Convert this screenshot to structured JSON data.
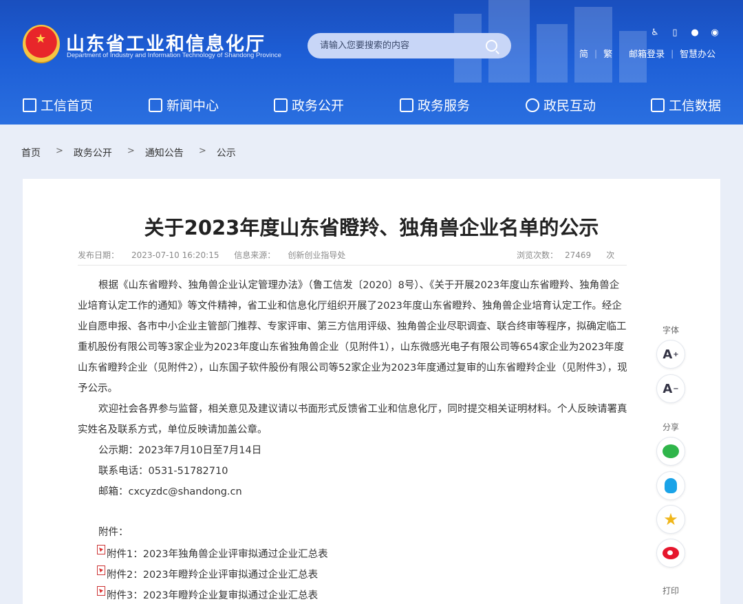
{
  "header": {
    "site_title": "山东省工业和信息化厅",
    "site_subtitle": "Department of Industry and Information Technology of Shandong Province",
    "search_placeholder": "请输入您要搜索的内容",
    "top_icons": [
      "accessibility-icon",
      "mobile-icon",
      "wechat-icon",
      "weibo-icon"
    ],
    "links": {
      "simplified": "简",
      "traditional": "繁",
      "mail_login": "邮箱登录",
      "smart_office": "智慧办公"
    },
    "sep": "|"
  },
  "nav": {
    "items": [
      {
        "label": "工信首页",
        "icon": "home-icon"
      },
      {
        "label": "新闻中心",
        "icon": "news-icon"
      },
      {
        "label": "政务公开",
        "icon": "monitor-icon"
      },
      {
        "label": "政务服务",
        "icon": "service-icon"
      },
      {
        "label": "政民互动",
        "icon": "chat-icon"
      },
      {
        "label": "工信数据",
        "icon": "database-icon"
      }
    ]
  },
  "breadcrumb": {
    "items": [
      "首页",
      "政务公开",
      "通知公告",
      "公示"
    ],
    "sep": ">"
  },
  "article": {
    "title": "关于2023年度山东省瞪羚、独角兽企业名单的公示",
    "publish_label": "发布日期：",
    "publish_date": "2023-07-10 16:20:15",
    "source_label": "信息来源：",
    "source": "创新创业指导处",
    "views_label": "浏览次数：",
    "views": "27469",
    "views_unit": "次",
    "paragraphs": [
      "根据《山东省瞪羚、独角兽企业认定管理办法》（鲁工信发〔2020〕8号）、《关于开展2023年度山东省瞪羚、独角兽企业培育认定工作的通知》等文件精神，省工业和信息化厅组织开展了2023年度山东省瞪羚、独角兽企业培育认定工作。经企业自愿申报、各市中小企业主管部门推荐、专家评审、第三方信用评级、独角兽企业尽职调查、联合终审等程序，拟确定临工重机股份有限公司等3家企业为2023年度山东省独角兽企业（见附件1），山东微感光电子有限公司等654家企业为2023年度山东省瞪羚企业（见附件2），山东国子软件股份有限公司等52家企业为2023年度通过复审的山东省瞪羚企业（见附件3），现予公示。",
      "欢迎社会各界参与监督，相关意见及建议请以书面形式反馈省工业和信息化厅，同时提交相关证明材料。个人反映请署真实姓名及联系方式，单位反映请加盖公章。"
    ],
    "period": "公示期：2023年7月10日至7月14日",
    "phone": "联系电话：0531-51782710",
    "email": "邮箱：cxcyzdc@shandong.cn",
    "attachments_label": "附件：",
    "attachments": [
      "附件1：2023年独角兽企业评审拟通过企业汇总表",
      "附件2：2023年瞪羚企业评审拟通过企业汇总表",
      "附件3：2023年瞪羚企业复审拟通过企业汇总表"
    ]
  },
  "side": {
    "font_label": "字体",
    "font_up": "A",
    "font_down": "A",
    "share_label": "分享",
    "print_label": "打印"
  }
}
